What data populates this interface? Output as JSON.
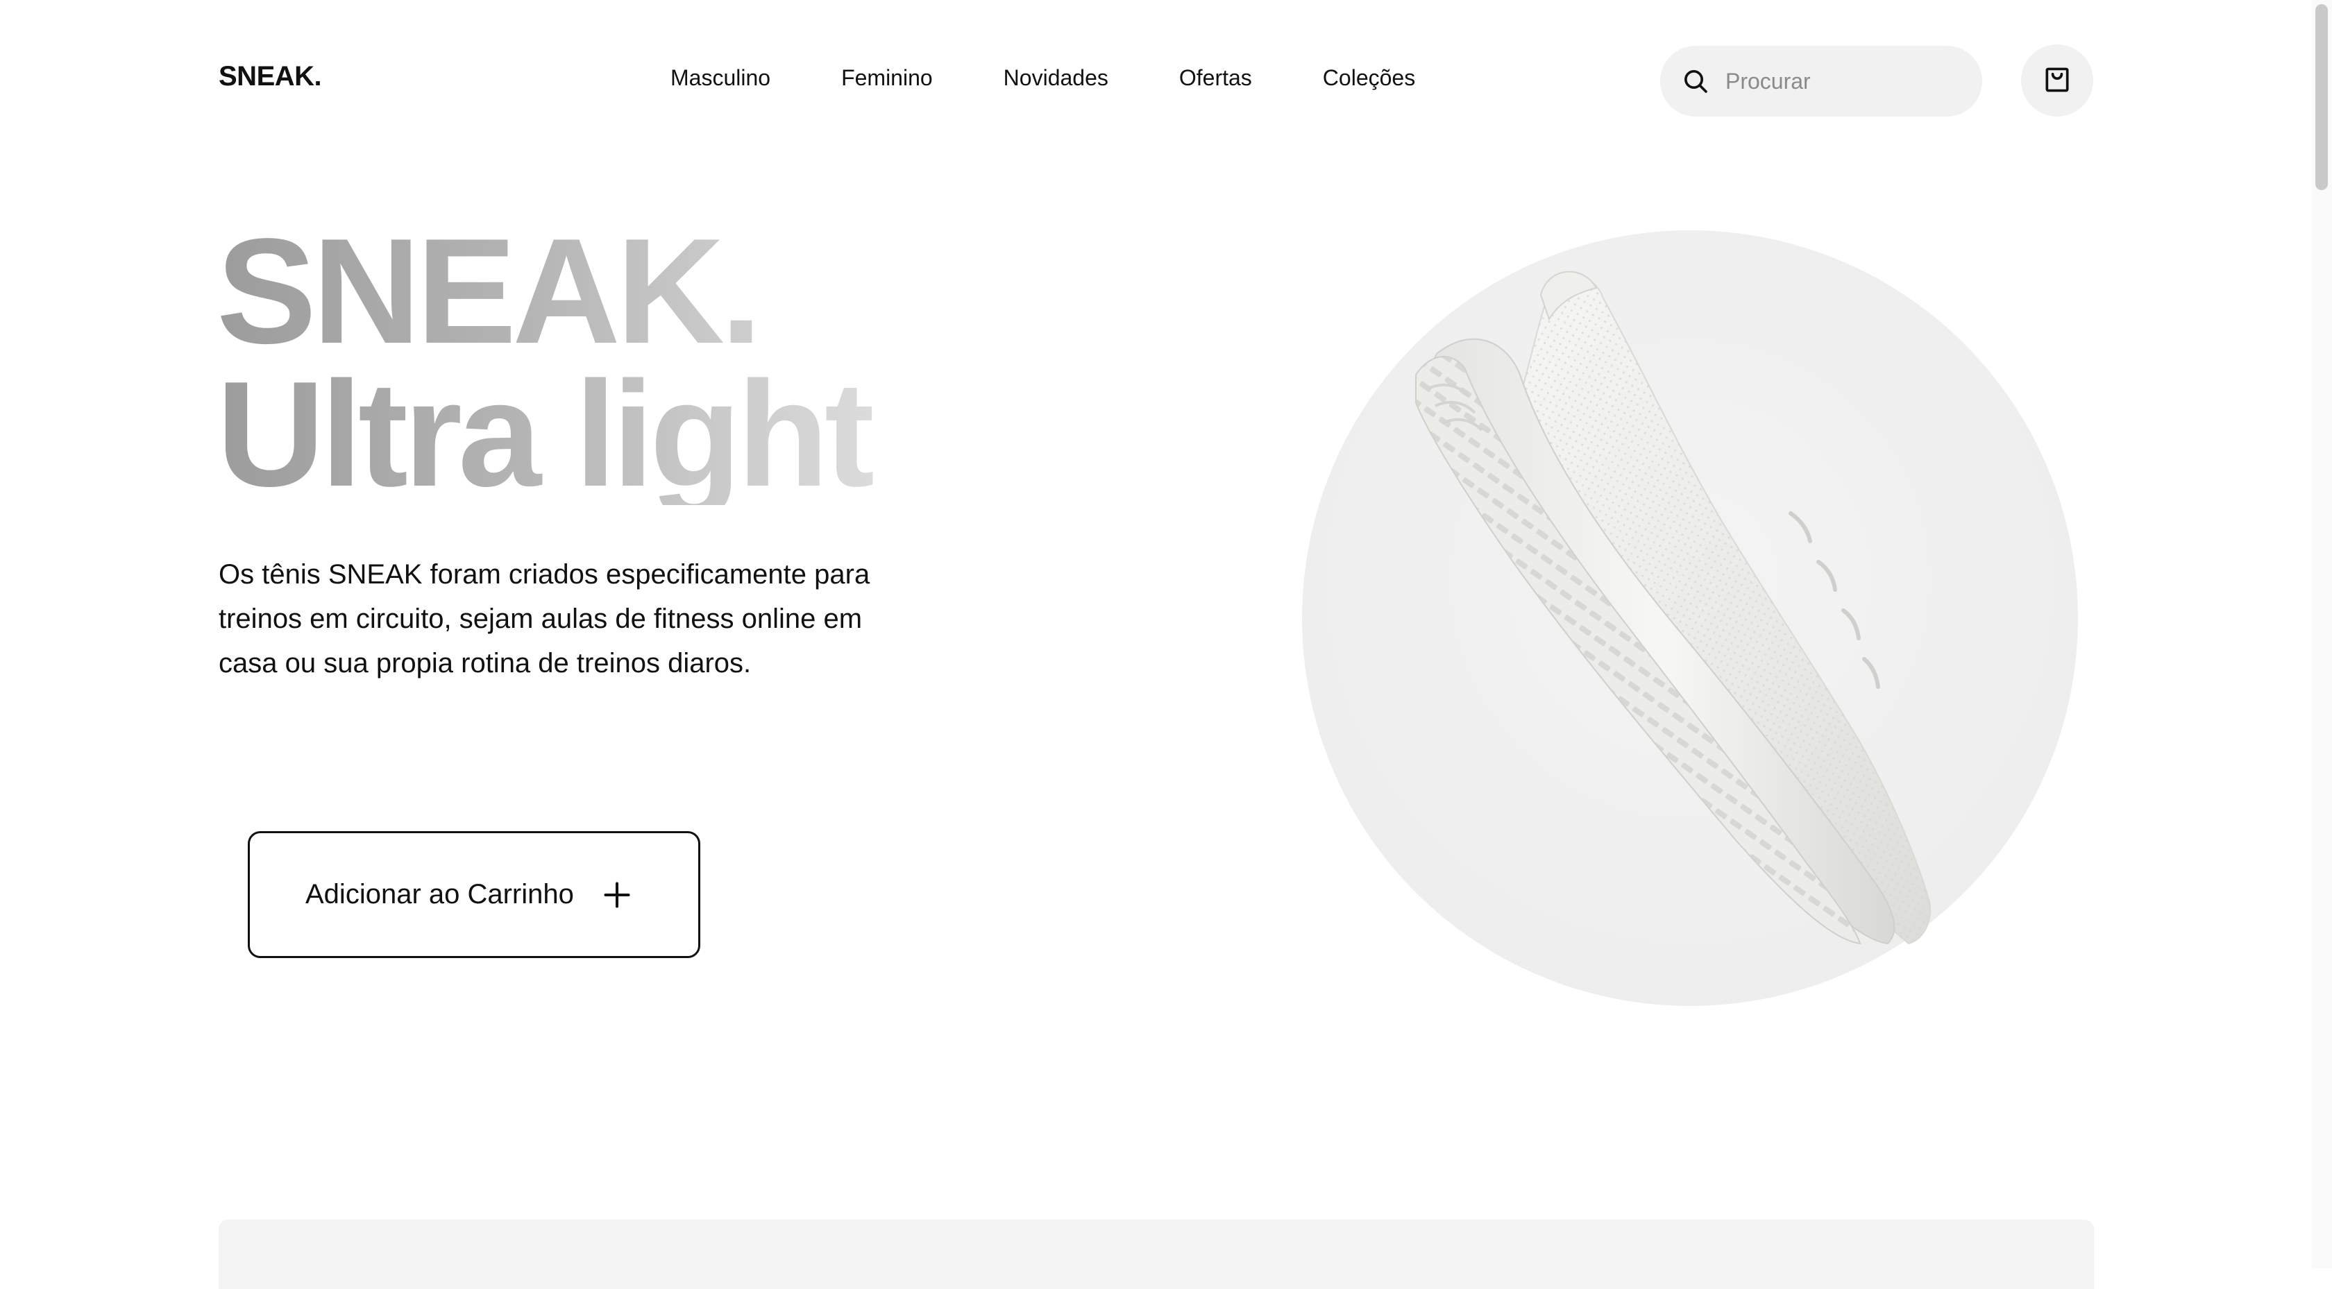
{
  "header": {
    "logo": "SNEAK.",
    "nav": [
      {
        "label": "Masculino"
      },
      {
        "label": "Feminino"
      },
      {
        "label": "Novidades"
      },
      {
        "label": "Ofertas"
      },
      {
        "label": "Coleções"
      }
    ],
    "search": {
      "placeholder": "Procurar",
      "value": "",
      "icon": "search-icon"
    },
    "cart": {
      "icon": "shopping-bag-icon"
    }
  },
  "hero": {
    "title_line1": "SNEAK.",
    "title_line2": "Ultra light",
    "description": "Os tênis SNEAK foram criados especificamente para treinos em circuito, sejam aulas de fitness online em casa ou sua propia rotina de treinos diaros.",
    "cta_label": "Adicionar ao Carrinho",
    "cta_icon": "plus-icon"
  },
  "colors": {
    "text": "#111111",
    "muted_title": "#a8a8a8",
    "surface": "#f1f1f1",
    "background": "#ffffff"
  }
}
